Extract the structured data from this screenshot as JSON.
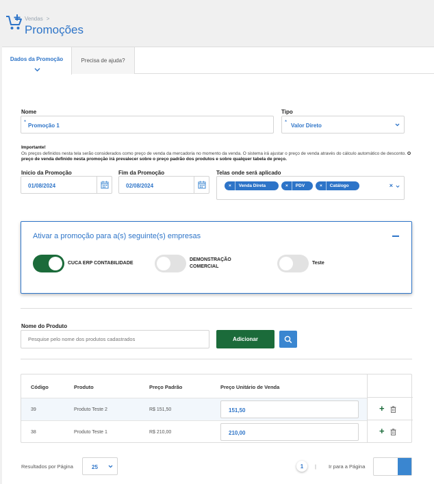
{
  "header": {
    "breadcrumb": "Vendas",
    "breadcrumb_sep": ">",
    "title": "Promoções",
    "icon": "cart-plus-icon"
  },
  "tabs": [
    {
      "label": "Dados da Promoção",
      "active": true
    },
    {
      "label": "Precisa de ajuda?",
      "active": false
    }
  ],
  "form": {
    "nome": {
      "label": "Nome",
      "value": "Promoção 1",
      "required_mark": "*"
    },
    "tipo": {
      "label": "Tipo",
      "value": "Valor Direto",
      "required_mark": "*"
    },
    "important": {
      "title": "Importante!",
      "text": "Os preços definidos nesta tela serão considerados como preço de venda da mercadoria no momento da venda. O sistema irá ajustar o preço de venda através do cálculo automático de desconto.",
      "bold_text": "O preço de venda definido nesta promoção irá prevalecer sobre o preço padrão dos produtos e sobre qualquer tabela de preço."
    },
    "inicio": {
      "label": "Inicio da Promoção",
      "value": "01/08/2024"
    },
    "fim": {
      "label": "Fim da Promoção",
      "value": "02/08/2024"
    },
    "telas": {
      "label": "Telas onde será aplicado",
      "chips": [
        "Venda Direta",
        "PDV",
        "Catálogo"
      ],
      "clear": "×",
      "remove": "×"
    }
  },
  "empresas": {
    "title": "Ativar a promoção para a(s) seguinte(s) empresas",
    "items": [
      {
        "label_line1": "CUCA ERP CONTABILIDADE",
        "label_line2": "",
        "enabled": true
      },
      {
        "label_line1": "DEMONSTRAÇÃO",
        "label_line2": "COMERCIAL",
        "enabled": false
      },
      {
        "label_line1": "Teste",
        "label_line2": "",
        "enabled": false
      }
    ],
    "colors": {
      "on": "#1b6b3a",
      "off": "#e2e2e2"
    }
  },
  "produto": {
    "label": "Nome do Produto",
    "placeholder": "Pesquise pelo nome dos produtos cadastrados",
    "add_label": "Adicionar"
  },
  "table": {
    "headers": [
      "Código",
      "Produto",
      "Preço Padrão",
      "Preço Unitário de Venda"
    ],
    "rows": [
      {
        "codigo": "39",
        "produto": "Produto Teste 2",
        "preco": "R$ 151,50",
        "venda": "151,50"
      },
      {
        "codigo": "38",
        "produto": "Produto Teste 1",
        "preco": "R$ 210,00",
        "venda": "210,00"
      }
    ],
    "add_symbol": "+"
  },
  "footer": {
    "per_page_label": "Resultados por Página",
    "per_page_value": "25",
    "page": "1",
    "page_sep": "|",
    "goto_label": "Ir para a Página"
  },
  "colors": {
    "accent": "#2d74c8",
    "primary_button": "#1b6b3a",
    "search_button": "#3a86d0"
  }
}
